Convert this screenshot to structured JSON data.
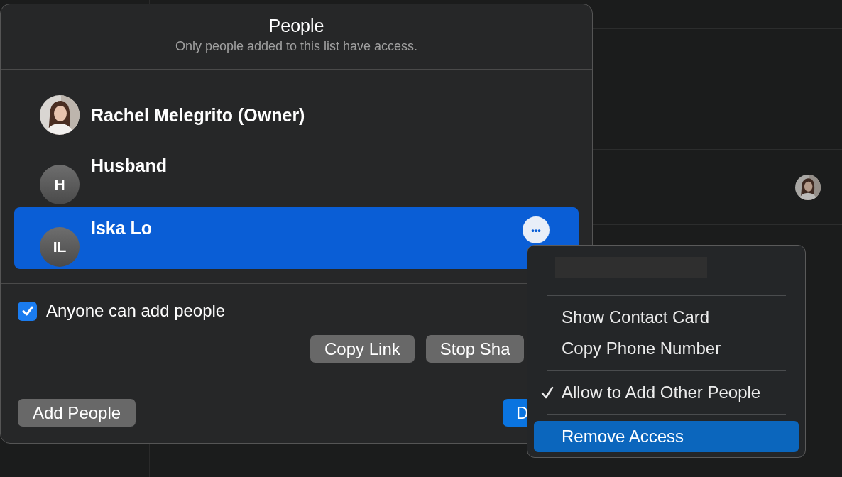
{
  "background": {
    "rows": [
      {
        "has_avatar": false
      },
      {
        "has_avatar": false
      },
      {
        "has_avatar": true
      },
      {
        "has_avatar": false
      }
    ]
  },
  "dialog": {
    "title": "People",
    "subtitle": "Only people added to this list have access.",
    "people": [
      {
        "name": "Rachel Melegrito (Owner)",
        "selected": false,
        "has_detail": false
      },
      {
        "name": "Husband",
        "avatar": {
          "kind": "initials",
          "initials": "H"
        },
        "selected": false,
        "has_detail": true
      },
      {
        "name": "Iska Lo",
        "avatar": {
          "kind": "initials",
          "initials": "IL"
        },
        "selected": true,
        "has_detail": true
      }
    ],
    "more_button": {
      "label": "•••"
    },
    "option": {
      "label": "Anyone can add people",
      "checked": true
    },
    "buttons": [
      {
        "label": "Copy Link",
        "kind": "secondary"
      },
      {
        "label": "Stop Sha",
        "kind": "secondary"
      }
    ],
    "footer_buttons": [
      {
        "label": "Add People",
        "kind": "secondary"
      },
      {
        "label": "D",
        "kind": "primary"
      }
    ]
  },
  "menu": {
    "items": [
      {
        "kind": "redacted"
      },
      {
        "kind": "separator"
      },
      {
        "kind": "action",
        "label": "Show Contact Card",
        "checked": false,
        "selected": false
      },
      {
        "kind": "action",
        "label": "Copy Phone Number",
        "checked": false,
        "selected": false
      },
      {
        "kind": "separator"
      },
      {
        "kind": "action",
        "label": "Allow to Add Other People",
        "checked": true,
        "selected": false
      },
      {
        "kind": "separator"
      },
      {
        "kind": "action",
        "label": "Remove Access",
        "checked": false,
        "selected": true
      }
    ]
  }
}
